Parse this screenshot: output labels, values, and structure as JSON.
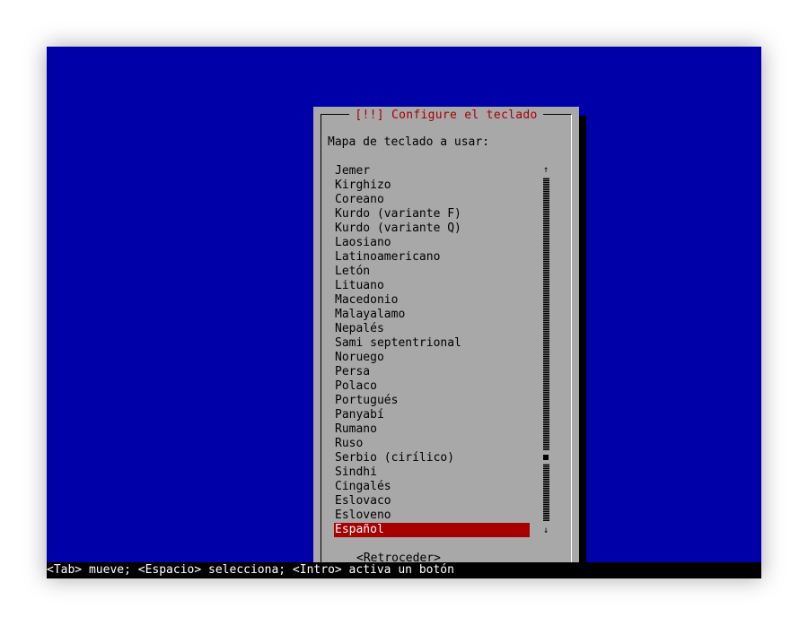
{
  "dialog": {
    "title": "[!!] Configure el teclado",
    "prompt": "Mapa de teclado a usar:",
    "items": [
      "Jemer",
      "Kirghizo",
      "Coreano",
      "Kurdo (variante F)",
      "Kurdo (variante Q)",
      "Laosiano",
      "Latinoamericano",
      "Letón",
      "Lituano",
      "Macedonio",
      "Malayalamo",
      "Nepalés",
      "Sami septentrional",
      "Noruego",
      "Persa",
      "Polaco",
      "Portugués",
      "Panyabí",
      "Rumano",
      "Ruso",
      "Serbio (cirílico)",
      "Sindhi",
      "Cingalés",
      "Eslovaco",
      "Esloveno",
      "Español"
    ],
    "selected_index": 25,
    "back_button": "<Retroceder>",
    "scroll_up_glyph": "↑",
    "scroll_down_glyph": "↓"
  },
  "status_bar": "<Tab> mueve; <Espacio> selecciona; <Intro> activa un botón",
  "colors": {
    "background": "#0000a8",
    "dialog": "#a8a8a8",
    "title": "#a80000",
    "selection": "#a80000",
    "statusbar": "#000000"
  }
}
